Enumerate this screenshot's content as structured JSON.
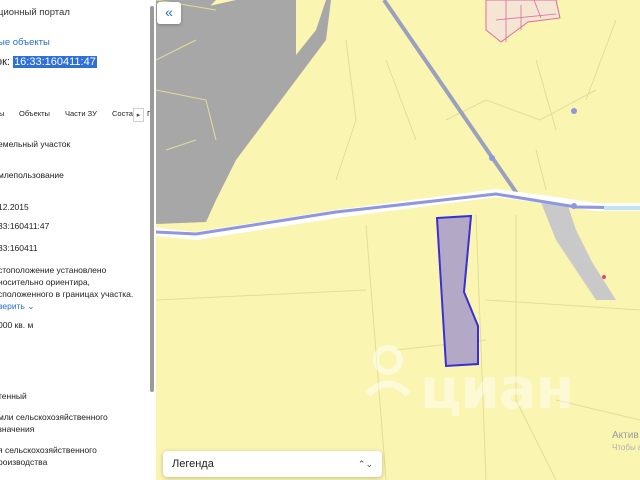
{
  "panel": {
    "portal_title": "ционный портал",
    "objects_link": "ые объекты",
    "cadastral_label": "ок:",
    "cadastral_number": "16:33:160411:47",
    "tabs": [
      "ы",
      "Объекты",
      "Части ЗУ",
      "Соста",
      "Г"
    ],
    "tab_next_icon": "chevron-right-icon",
    "fields": [
      "емельный участок",
      "млепользование",
      "12.2015",
      "33:160411:47",
      "33:160411",
      "стоположение установлено",
      "носительно ориентира,",
      "сположенного в границах участка.",
      "000 кв. м",
      "тенный",
      "мли сельскохозяйственного",
      "значения",
      "я сельскохозяйственного",
      "роизводства"
    ],
    "show_more": "верить"
  },
  "map": {
    "collapse_label": "«",
    "legend_label": "Легенда",
    "legend_icon": "chevron-updown-icon",
    "watermark": "циан",
    "activate_line1": "Актив",
    "activate_line2": "Чтобы а"
  },
  "colors": {
    "map_background": "#fbf5b2",
    "road_blue": "#8e97df",
    "parcel_fill": "#b3a8c6",
    "parcel_stroke": "#3a2fd0",
    "grey_area": "#a7a7a7",
    "link_blue": "#1e6ed2"
  }
}
